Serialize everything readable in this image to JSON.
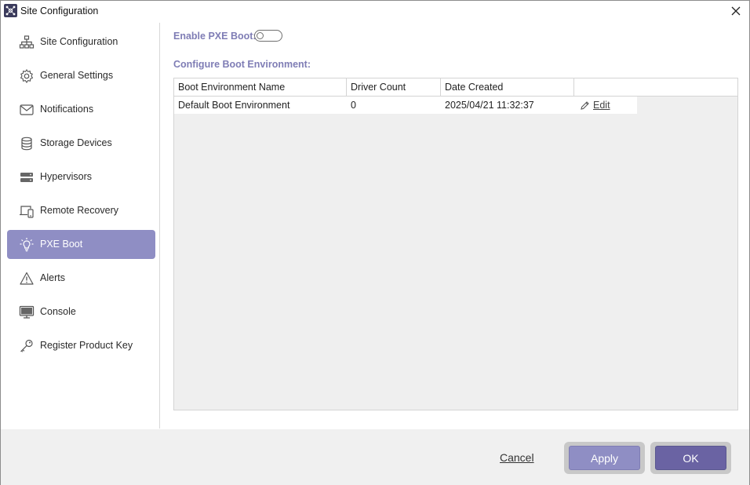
{
  "window": {
    "title": "Site Configuration"
  },
  "sidebar": {
    "items": [
      {
        "label": "Site Configuration",
        "icon": "sitemap-icon"
      },
      {
        "label": "General Settings",
        "icon": "gear-icon"
      },
      {
        "label": "Notifications",
        "icon": "envelope-icon"
      },
      {
        "label": "Storage Devices",
        "icon": "database-icon"
      },
      {
        "label": "Hypervisors",
        "icon": "server-icon"
      },
      {
        "label": "Remote Recovery",
        "icon": "devices-icon"
      },
      {
        "label": "PXE Boot",
        "icon": "lightbulb-icon",
        "active": true
      },
      {
        "label": "Alerts",
        "icon": "warning-icon"
      },
      {
        "label": "Console",
        "icon": "monitor-icon"
      },
      {
        "label": "Register Product Key",
        "icon": "key-icon"
      }
    ]
  },
  "main": {
    "enable_pxe_label": "Enable PXE Boot:",
    "enable_pxe_on": false,
    "configure_label": "Configure Boot Environment:",
    "table": {
      "columns": [
        "Boot Environment Name",
        "Driver Count",
        "Date Created",
        ""
      ],
      "rows": [
        {
          "name": "Default Boot Environment",
          "driver_count": "0",
          "date_created": "2025/04/21 11:32:37",
          "action": "Edit"
        }
      ]
    }
  },
  "footer": {
    "cancel": "Cancel",
    "apply": "Apply",
    "ok": "OK"
  },
  "colors": {
    "accent": "#8f8ec4",
    "accent_dark": "#6a63a3",
    "label": "#7f7db5"
  }
}
